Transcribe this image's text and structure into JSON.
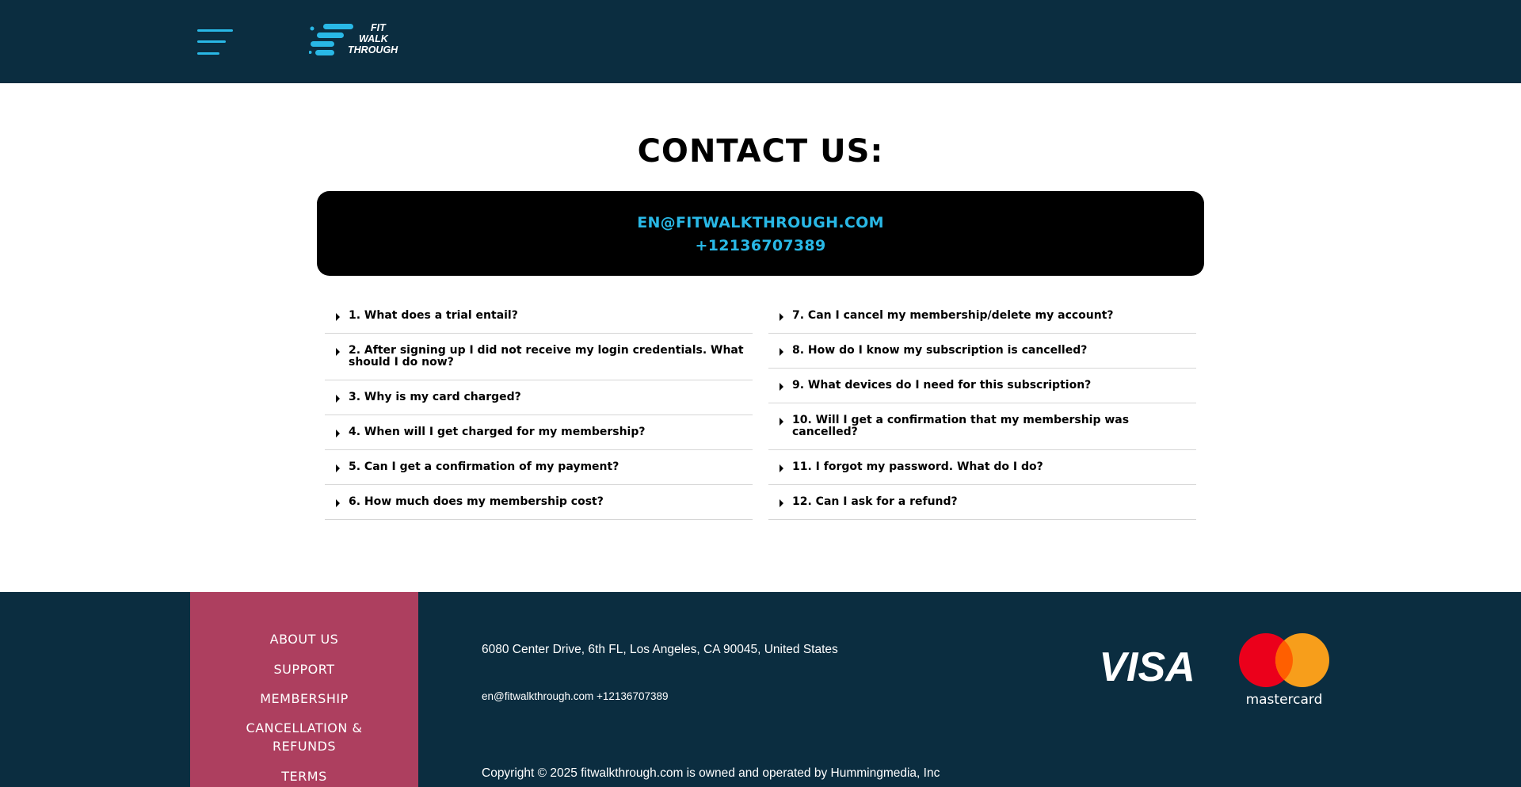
{
  "header": {
    "menu_icon": "hamburger-icon",
    "logo": {
      "line1": "FIT",
      "line2": "WALK",
      "line3": "THROUGH"
    }
  },
  "main": {
    "title": "CONTACT US:",
    "contact": {
      "email": "EN@FITWALKTHROUGH.COM",
      "phone": "+12136707389"
    },
    "faq_left": [
      "1. What does a trial entail?",
      "2. After signing up I did not receive my login credentials. What should I do now?",
      "3. Why is my card charged?",
      "4. When will I get charged for my membership?",
      "5. Can I get a confirmation of my payment?",
      "6. How much does my membership cost?"
    ],
    "faq_right": [
      "7. Can I cancel my membership/delete my account?",
      "8. How do I know my subscription is cancelled?",
      "9. What devices do I need for this subscription?",
      "10. Will I get a confirmation that my membership was cancelled?",
      "11. I forgot my password. What do I do?",
      "12. Can I ask for a refund?"
    ]
  },
  "footer": {
    "nav": [
      "ABOUT US",
      "SUPPORT",
      "MEMBERSHIP",
      "CANCELLATION & REFUNDS",
      "TERMS"
    ],
    "address": "6080 Center Drive, 6th FL, Los Angeles, CA 90045, United States",
    "contact": "en@fitwalkthrough.com +12136707389",
    "copyright": "Copyright © 2025 fitwalkthrough.com is owned and operated by Hummingmedia, Inc",
    "payment": {
      "visa": "VISA",
      "mastercard": "mastercard"
    }
  },
  "colors": {
    "header_bg": "#0b2d40",
    "accent": "#29b8e6",
    "footer_nav_bg": "#ad3f5f",
    "contact_box_bg": "#000000"
  }
}
